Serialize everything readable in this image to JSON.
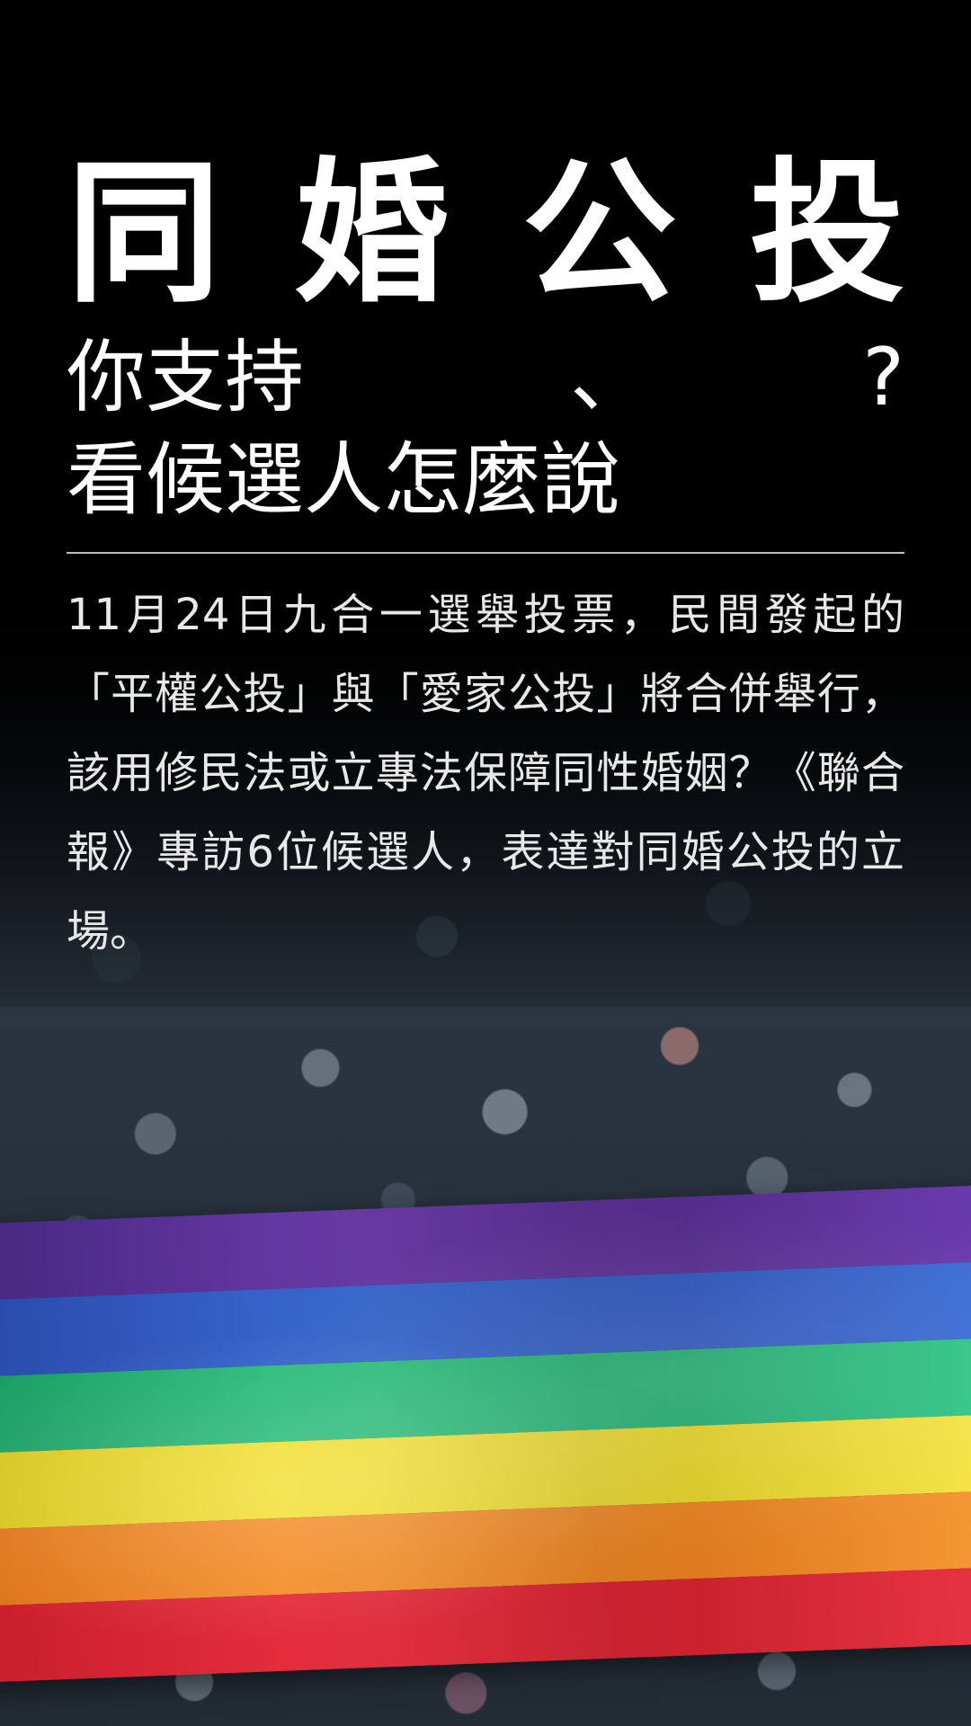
{
  "headline": {
    "chars": [
      "同",
      "婚",
      "公",
      "投"
    ]
  },
  "subtitle": {
    "part_a": "你支持",
    "part_b": "、",
    "part_c": "?",
    "line_2": "看候選人怎麼說"
  },
  "lede": "11月24日九合一選舉投票，民間發起的「平權公投」與「愛家公投」將合併舉行，該用修民法或立專法保障同性婚姻？《聯合報》專訪6位候選人，表達對同婚公投的立場。"
}
